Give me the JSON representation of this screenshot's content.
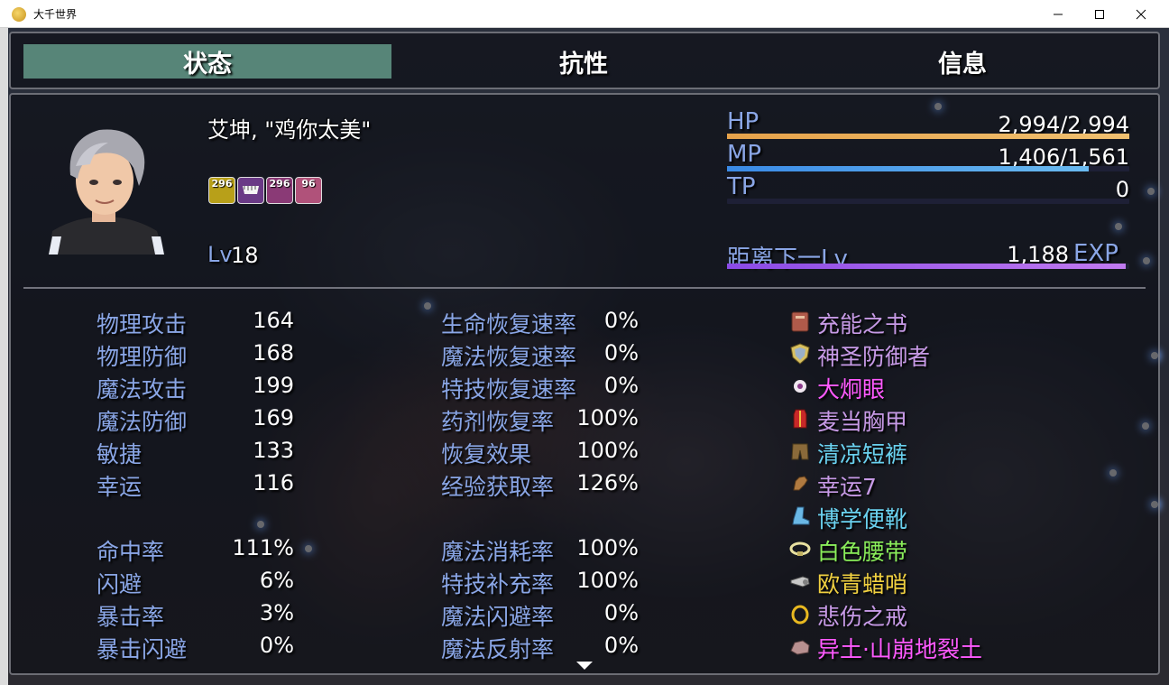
{
  "window": {
    "title": "大千世界"
  },
  "tabs": [
    {
      "label": "状态",
      "active": true
    },
    {
      "label": "抗性",
      "active": false
    },
    {
      "label": "信息",
      "active": false
    }
  ],
  "actor": {
    "name": "艾坤, \"鸡你太美\"",
    "level_label": "Lv",
    "level": "18",
    "states": [
      {
        "turns": "296",
        "color": "#b8a019",
        "icon": "ankh-icon"
      },
      {
        "turns": "",
        "color": "#6a3a86",
        "icon": "teeth-icon"
      },
      {
        "turns": "296",
        "color": "#8a3a76",
        "icon": "ghost-icon"
      },
      {
        "turns": "96",
        "color": "#b0527a",
        "icon": "fist-icon"
      }
    ]
  },
  "gauges": {
    "hp": {
      "label": "HP",
      "value": "2,994/2,994",
      "fraction": 1.0,
      "color_from": "#e6a24a",
      "color_to": "#f0c070"
    },
    "mp": {
      "label": "MP",
      "value": "1,406/1,561",
      "fraction": 0.9,
      "color_from": "#3a8ae6",
      "color_to": "#6abaf0"
    },
    "tp": {
      "label": "TP",
      "value": "0",
      "fraction": 0.0,
      "color_from": "#4aaa4a",
      "color_to": "#8ae68a"
    },
    "exp": {
      "label": "距离下一Lv",
      "value": "1,188",
      "unit": "EXP",
      "fraction": 0.99,
      "color_from": "#8a4ae6",
      "color_to": "#c07af0"
    }
  },
  "params_col1": [
    {
      "label": "物理攻击",
      "value": "164"
    },
    {
      "label": "物理防御",
      "value": "168"
    },
    {
      "label": "魔法攻击",
      "value": "199"
    },
    {
      "label": "魔法防御",
      "value": "169"
    },
    {
      "label": "敏捷",
      "value": "133"
    },
    {
      "label": "幸运",
      "value": "116"
    },
    {
      "label": "命中率",
      "value": "111%"
    },
    {
      "label": "闪避",
      "value": "6%"
    },
    {
      "label": "暴击率",
      "value": "3%"
    },
    {
      "label": "暴击闪避",
      "value": "0%"
    }
  ],
  "params_col2": [
    {
      "label": "生命恢复速率",
      "value": "0%"
    },
    {
      "label": "魔法恢复速率",
      "value": "0%"
    },
    {
      "label": "特技恢复速率",
      "value": "0%"
    },
    {
      "label": "药剂恢复率",
      "value": "100%"
    },
    {
      "label": "恢复效果",
      "value": "100%"
    },
    {
      "label": "经验获取率",
      "value": "126%"
    },
    {
      "label": "魔法消耗率",
      "value": "100%"
    },
    {
      "label": "特技补充率",
      "value": "100%"
    },
    {
      "label": "魔法闪避率",
      "value": "0%"
    },
    {
      "label": "魔法反射率",
      "value": "0%"
    }
  ],
  "equipment": [
    {
      "name": "充能之书",
      "color": "#c79ae6",
      "icon": "book-icon"
    },
    {
      "name": "神圣防御者",
      "color": "#c79ae6",
      "icon": "shield-icon"
    },
    {
      "name": "大炯眼",
      "color": "#ff5aff",
      "icon": "eyeball-icon"
    },
    {
      "name": "麦当胸甲",
      "color": "#c79ae6",
      "icon": "armor-icon"
    },
    {
      "name": "清凉短裤",
      "color": "#6ad2f0",
      "icon": "shorts-icon"
    },
    {
      "name": "幸运7",
      "color": "#c79ae6",
      "icon": "glove-icon"
    },
    {
      "name": "博学便靴",
      "color": "#6ad2f0",
      "icon": "boot-icon"
    },
    {
      "name": "白色腰带",
      "color": "#8aee5a",
      "icon": "belt-icon"
    },
    {
      "name": "欧青蜡哨",
      "color": "#f0d040",
      "icon": "whistle-icon"
    },
    {
      "name": "悲伤之戒",
      "color": "#c79ae6",
      "icon": "ring-icon"
    },
    {
      "name": "异土·山崩地裂土",
      "color": "#ff5aff",
      "icon": "stone-icon"
    }
  ]
}
